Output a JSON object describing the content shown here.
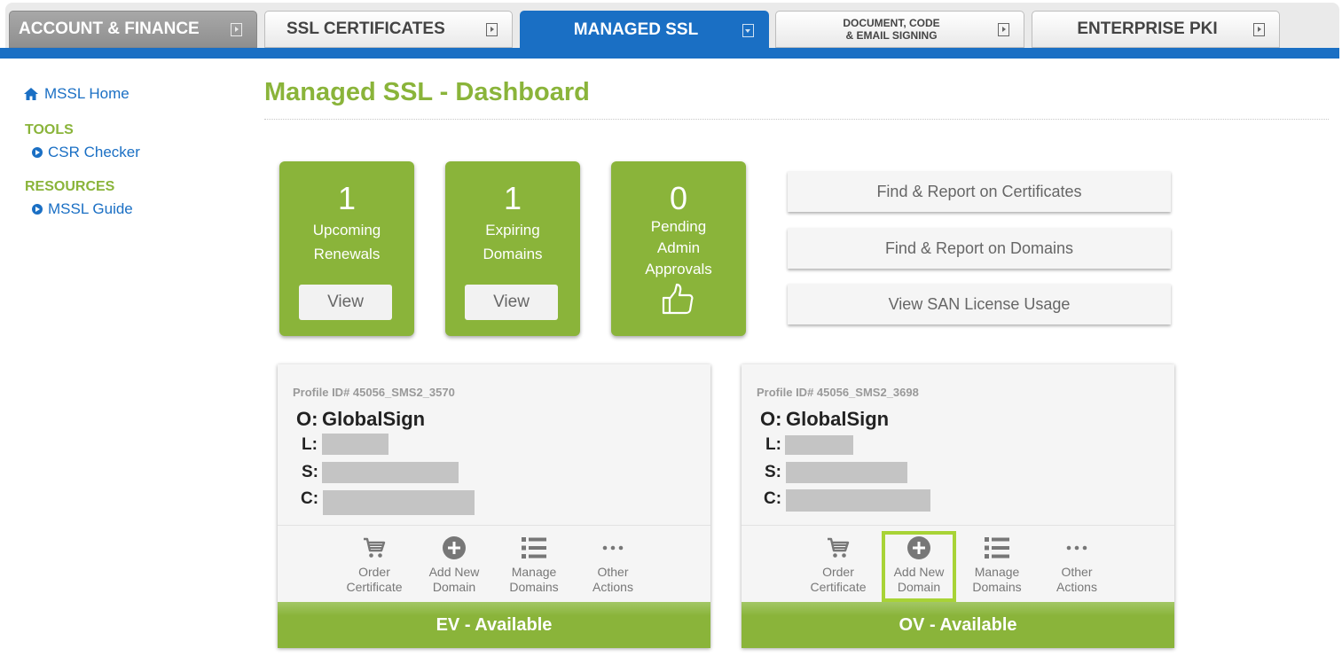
{
  "tabs": [
    {
      "label": "ACCOUNT & FINANCE"
    },
    {
      "label": "SSL CERTIFICATES"
    },
    {
      "label": "MANAGED SSL"
    },
    {
      "label_line1": "DOCUMENT, CODE",
      "label_line2": "& EMAIL SIGNING"
    },
    {
      "label": "ENTERPRISE PKI"
    }
  ],
  "sidebar": {
    "home": "MSSL Home",
    "tools_heading": "TOOLS",
    "csr_checker": "CSR Checker",
    "resources_heading": "RESOURCES",
    "mssl_guide": "MSSL Guide"
  },
  "page_title": "Managed SSL - Dashboard",
  "stats": [
    {
      "count": "1",
      "line1": "Upcoming",
      "line2": "Renewals",
      "button": "View"
    },
    {
      "count": "1",
      "line1": "Expiring",
      "line2": "Domains",
      "button": "View"
    },
    {
      "count": "0",
      "line1": "Pending",
      "line2": "Admin",
      "line3": "Approvals",
      "icon": "thumbs-up-icon"
    }
  ],
  "actions": {
    "find_certificates": "Find & Report on Certificates",
    "find_domains": "Find & Report on Domains",
    "san_usage": "View SAN License Usage"
  },
  "profiles": [
    {
      "profile_id": "Profile ID# 45056_SMS2_3570",
      "org_key": "O:",
      "org": "GlobalSign",
      "l_key": "L:",
      "s_key": "S:",
      "c_key": "C:",
      "order_line1": "Order",
      "order_line2": "Certificate",
      "add_line1": "Add New",
      "add_line2": "Domain",
      "manage_line1": "Manage",
      "manage_line2": "Domains",
      "other_line1": "Other",
      "other_line2": "Actions",
      "status": "EV - Available"
    },
    {
      "profile_id": "Profile ID# 45056_SMS2_3698",
      "org_key": "O:",
      "org": "GlobalSign",
      "l_key": "L:",
      "s_key": "S:",
      "c_key": "C:",
      "order_line1": "Order",
      "order_line2": "Certificate",
      "add_line1": "Add New",
      "add_line2": "Domain",
      "manage_line1": "Manage",
      "manage_line2": "Domains",
      "other_line1": "Other",
      "other_line2": "Actions",
      "status": "OV - Available"
    }
  ],
  "colors": {
    "brand_green": "#8ab43a",
    "brand_blue": "#1a6fc4",
    "highlight": "#a8d336"
  }
}
